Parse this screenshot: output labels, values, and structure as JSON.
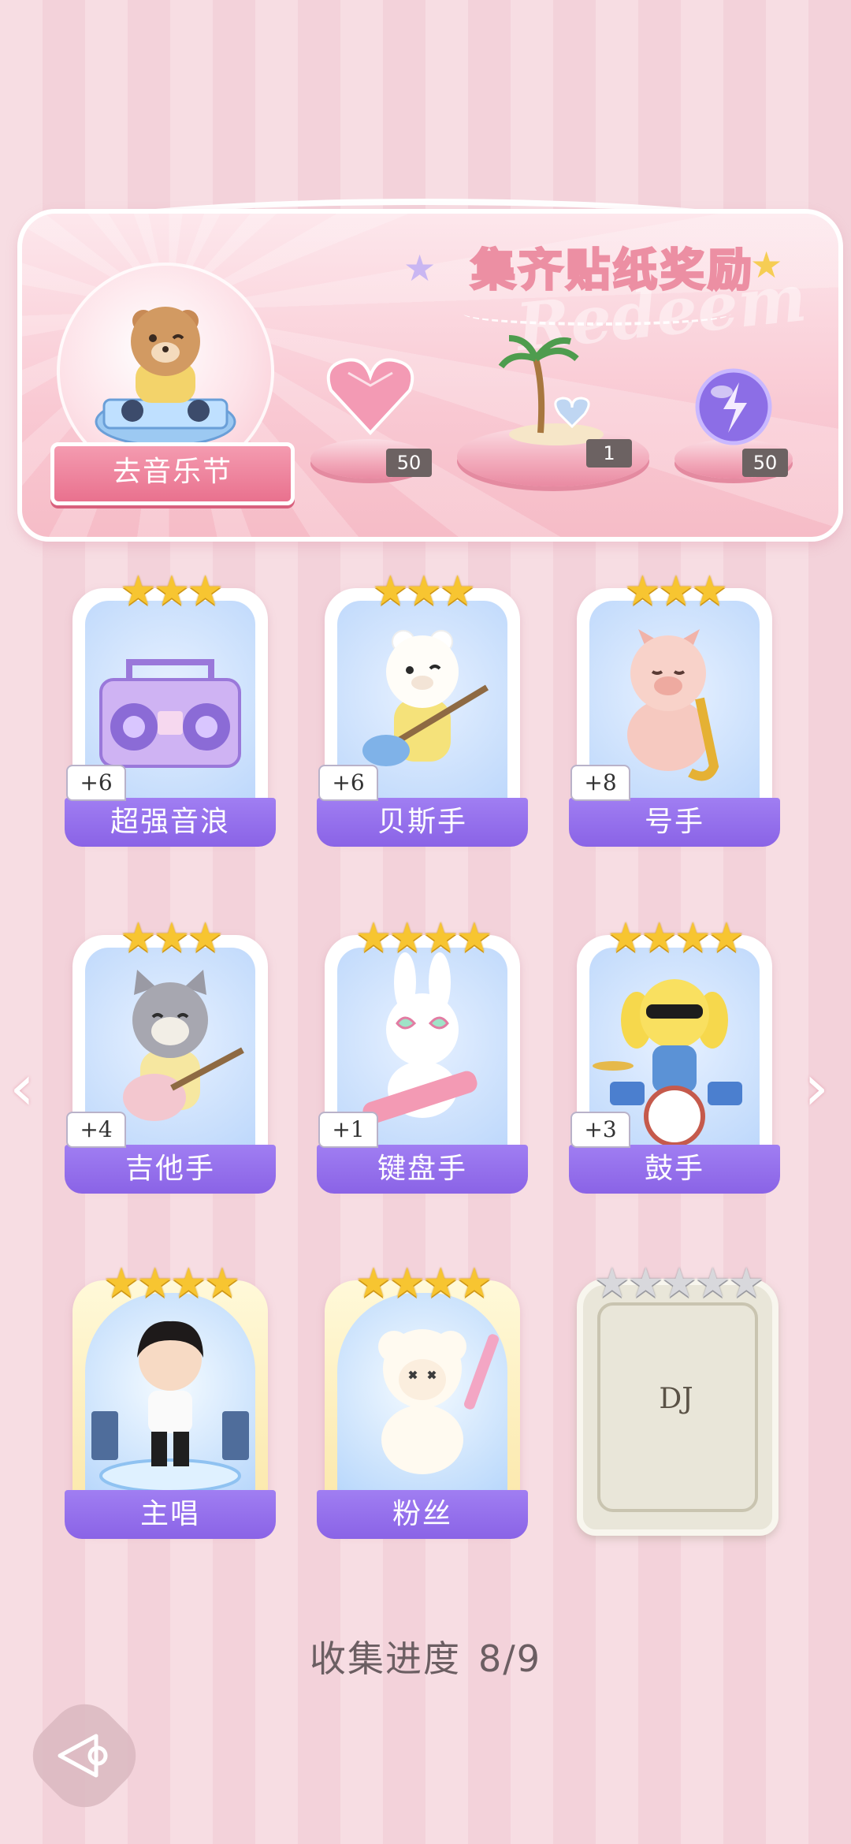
{
  "banner": {
    "title": "集齐贴纸奖励",
    "watermark": "Redeem",
    "go_button": "去音乐节",
    "rewards": [
      {
        "icon": "pink-heart-gem-icon",
        "count": "50"
      },
      {
        "icon": "palm-island-decor-icon",
        "count": "1"
      },
      {
        "icon": "purple-energy-orb-icon",
        "count": "50"
      }
    ]
  },
  "cards": [
    {
      "name": "超强音浪",
      "stars": "★★★",
      "bonus": "+6",
      "icon": "boombox-icon"
    },
    {
      "name": "贝斯手",
      "stars": "★★★",
      "bonus": "+6",
      "icon": "bear-bassist-icon"
    },
    {
      "name": "号手",
      "stars": "★★★",
      "bonus": "+8",
      "icon": "pig-saxophone-icon"
    },
    {
      "name": "吉他手",
      "stars": "★★★",
      "bonus": "+4",
      "icon": "cat-guitarist-icon"
    },
    {
      "name": "键盘手",
      "stars": "★★★★",
      "bonus": "+1",
      "icon": "bunny-keytar-icon"
    },
    {
      "name": "鼓手",
      "stars": "★★★★",
      "bonus": "+3",
      "icon": "dog-drummer-icon"
    },
    {
      "name": "主唱",
      "stars": "★★★★",
      "icon": "boy-singer-icon"
    },
    {
      "name": "粉丝",
      "stars": "★★★★",
      "icon": "sheep-fan-icon"
    },
    {
      "name": "DJ",
      "stars": "★★★★★",
      "icon": "locked-card-icon"
    }
  ],
  "progress": {
    "label": "收集进度",
    "value": "8/9"
  },
  "nav": {
    "prev": "‹",
    "next": "›"
  }
}
